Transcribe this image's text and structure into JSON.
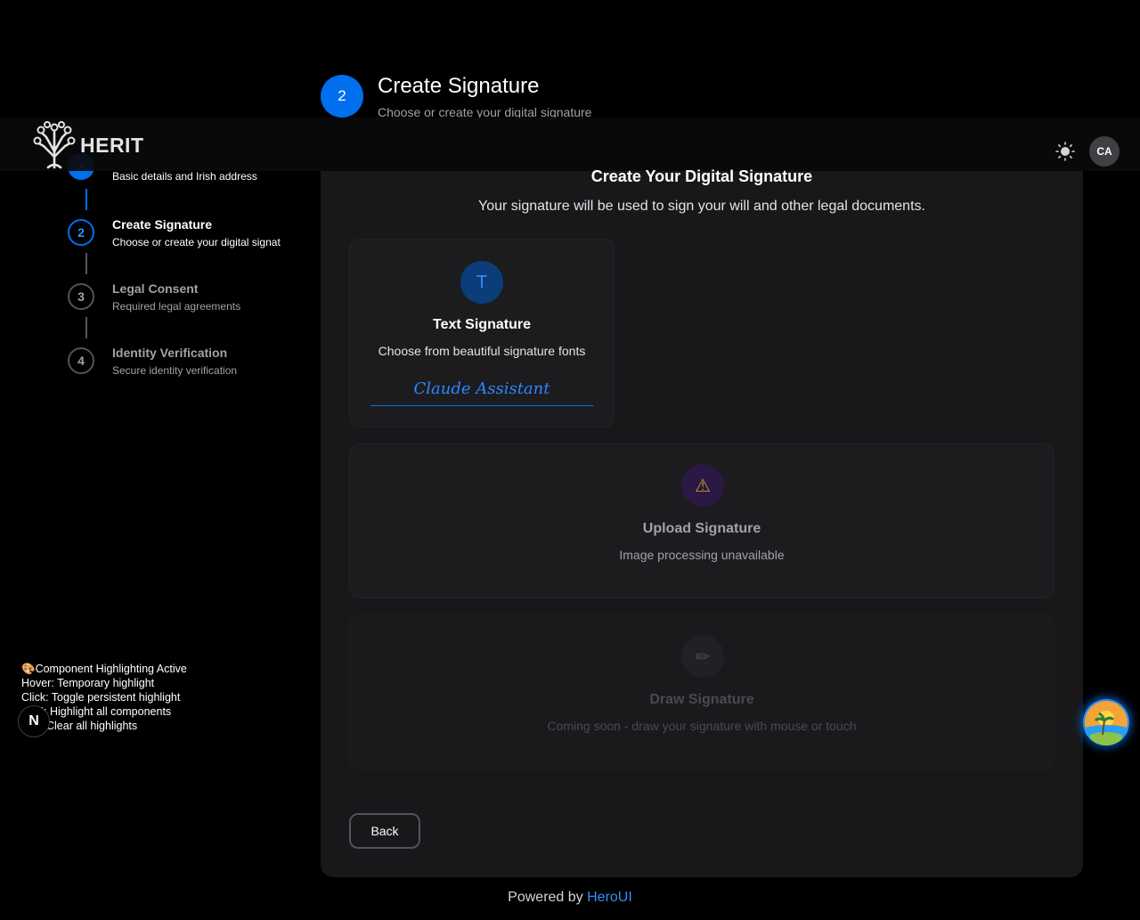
{
  "step_header": {
    "number": "2",
    "title": "Create Signature",
    "subtitle": "Choose or create your digital signature"
  },
  "navbar": {
    "logo_text": "HERIT",
    "avatar_initials": "CA"
  },
  "stepper": {
    "steps": [
      {
        "number": "1",
        "title": "",
        "description": "Basic details and Irish address",
        "status": "complete"
      },
      {
        "number": "2",
        "title": "Create Signature",
        "description": "Choose or create your digital signat",
        "status": "active"
      },
      {
        "number": "3",
        "title": "Legal Consent",
        "description": "Required legal agreements",
        "status": "pending"
      },
      {
        "number": "4",
        "title": "Identity Verification",
        "description": "Secure identity verification",
        "status": "pending"
      }
    ]
  },
  "main": {
    "title": "Create Your Digital Signature",
    "subtitle": "Your signature will be used to sign your will and other legal documents.",
    "options": [
      {
        "icon": "T",
        "title": "Text Signature",
        "description": "Choose from beautiful signature fonts",
        "preview": "Claude Assistant"
      },
      {
        "icon": "⚠",
        "title": "Upload Signature",
        "description": "Image processing unavailable"
      },
      {
        "icon": "✏",
        "title": "Draw Signature",
        "description": "Coming soon - draw your signature with mouse or touch"
      }
    ],
    "back_label": "Back"
  },
  "footer": {
    "powered_prefix": "Powered by",
    "powered_link": "HeroUI"
  },
  "debug": {
    "lines": [
      "🎨Component Highlighting Active",
      "Hover: Temporary highlight",
      "Click: Toggle persistent highlight",
      "H: Highlight all components",
      "Clear all highlights"
    ],
    "badge": "N"
  },
  "colors": {
    "primary": "#006FEE",
    "background": "#000000",
    "card": "#18181b"
  }
}
